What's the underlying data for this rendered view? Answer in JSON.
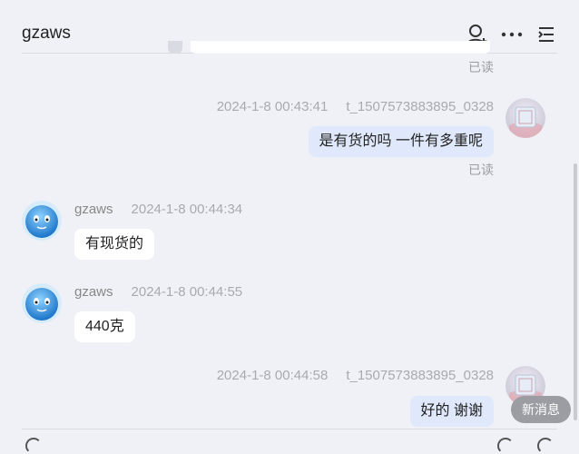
{
  "header": {
    "title": "gzaws"
  },
  "icons": {
    "add_user": "add-user-icon",
    "more": "more-icon",
    "menu": "menu-icon"
  },
  "messages": [
    {
      "read": "已读"
    },
    {
      "time": "2024-1-8 00:43:41",
      "sender": "t_1507573883895_0328",
      "text": "是有货的吗 一件有多重呢",
      "read": "已读"
    },
    {
      "sender": "gzaws",
      "time": "2024-1-8 00:44:34",
      "text": "有现货的"
    },
    {
      "sender": "gzaws",
      "time": "2024-1-8 00:44:55",
      "text": "440克"
    },
    {
      "time": "2024-1-8 00:44:58",
      "sender": "t_1507573883895_0328",
      "text": "好的 谢谢"
    }
  ],
  "new_message_label": "新消息",
  "colors": {
    "me_bubble": "#e0e8fb",
    "other_bubble": "#ffffff",
    "background": "#f0f1f6"
  }
}
